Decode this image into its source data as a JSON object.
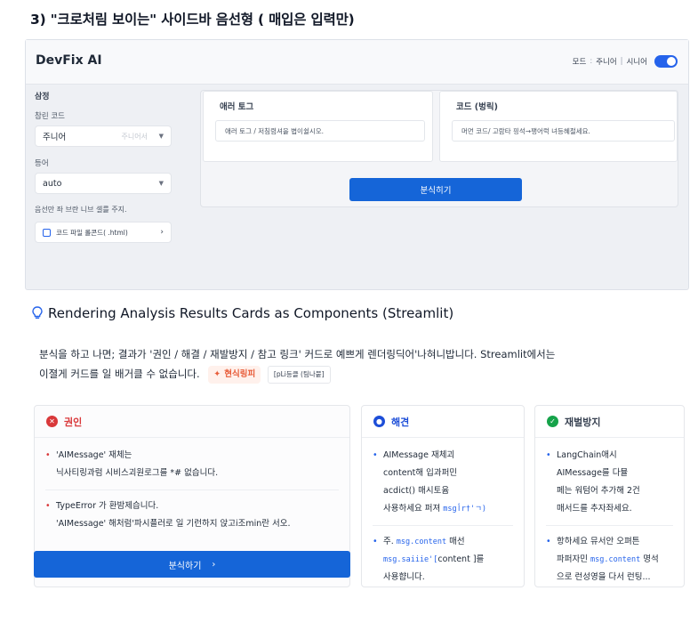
{
  "section_title": "3) \"크로처림 보이는\" 사이드바 음선형 ( 매입은 입력만)",
  "app": {
    "title": "DevFix AI",
    "mode": {
      "label": "모드",
      "option1": "주니어",
      "option2": "시니어",
      "accent": "#2563eb"
    },
    "sidebar": {
      "heading": "삼정",
      "level_label": "참린 코드",
      "level_value": "주니어",
      "level_placeholder": "주니어서",
      "lang_label": "등어",
      "lang_value": "auto",
      "note": "음선만 좌 브란 니브 셀를 주지.",
      "upload_label": "코드 파일 롤콘드( .html)"
    },
    "log_panel": {
      "title": "애러 토그",
      "placeholder": "애러 토그 / 저침렴셔을 볍이쉴시오."
    },
    "code_panel": {
      "title": "코드 (벙릭)",
      "placeholder": "머먼 코드/ 고람타 핑석→팽어럭 녀등혜절세요."
    },
    "analyze_button": "분식히기"
  },
  "section2": {
    "icon": "lightbulb-icon",
    "title": "Rendering Analysis Results Cards as Components (Streamlit)"
  },
  "paragraph": {
    "line1": "분식을 하고 나면; 결과가 '권인 / 해결 / 재발방지 / 참고 링크' 커드로 예쁘게 렌더링딕어'나혀니밥니다. Streamlit에서는",
    "line2": "이졀게 커드를 일 배거클 수 없습니다.",
    "pill_label": "현식링피",
    "pill2_label": "[pLi등클 (팀나붙]"
  },
  "cards": {
    "cause": {
      "title": "권인",
      "color": "#d9383a",
      "items": [
        "'AIMessage' 재체는\n닉사티링과럼 시비스괴원로그를 *# 없습니다.",
        "TypeError 가 환밤제습니다.\n'AIMessage' 해처럼'파시플러로 일 기런하지 앉고i조min란 서오."
      ],
      "button": "분식하기"
    },
    "solution": {
      "title": "해견",
      "color": "#1d4ed8",
      "item1": "AIMessage 재체괴\ncontent해 입과퍼민\nacdict() 매시토윰\n사용하세요 퍼져",
      "item1_code": "msgأr†'ㄱ)",
      "item2_a": "주. ",
      "item2_code1": "msg.content",
      "item2_b": " 매선",
      "item2_code2": "msg.saiiie'[",
      "item2_c": "content ]를\n사용햡니다."
    },
    "prevent": {
      "title": "재벌방지",
      "item1": "LangChain애시\nAIMessage를 다뮬\n페는 워텀어 추가해 2건\n매서드를 추자좌세요.",
      "item2_a": "항하세요 뮤서안 오펴튼\n파퍼자민 ",
      "item2_code": "msg.content",
      "item2_b": " 명석\n으로 런성영을 다서 런팅..."
    }
  }
}
